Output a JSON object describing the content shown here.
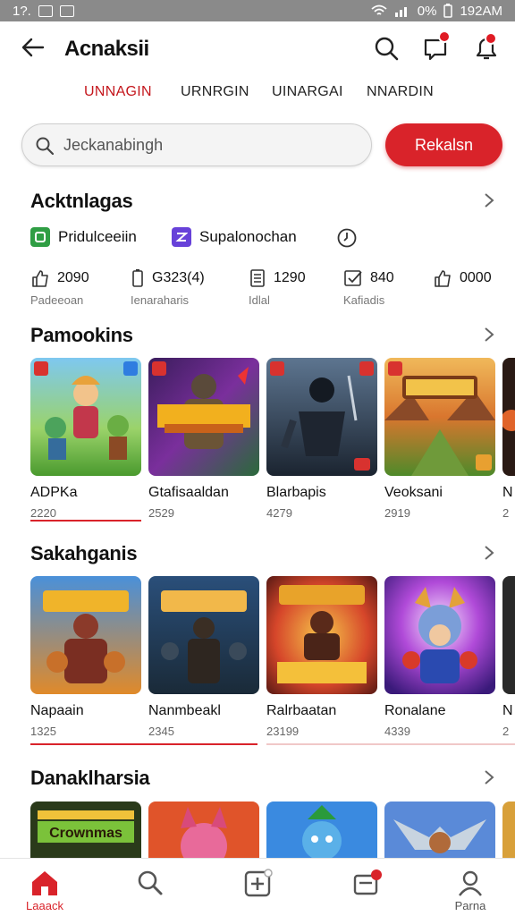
{
  "status": {
    "left_text": "1?.",
    "battery": "0%",
    "time": "192AM"
  },
  "appbar": {
    "title": "Acnaksii"
  },
  "tabs": [
    "UNNAGIN",
    "URNRGIN",
    "UINARGAI",
    "NNARDIN"
  ],
  "search": {
    "placeholder": "Jeckanabingh",
    "button": "Rekalsn"
  },
  "section1": {
    "title": "Acktnlagas",
    "chips": [
      {
        "label": "Pridulceeiin",
        "icon": "green-game-icon",
        "color": "#2f9e44"
      },
      {
        "label": "Supalonochan",
        "icon": "purple-chart-icon",
        "color": "#6741d9"
      },
      {
        "label": "",
        "icon": "clock-icon",
        "color": "#333333"
      }
    ],
    "stats": [
      {
        "value": "2090",
        "label": "Padeeoan",
        "icon": "thumb-up-icon"
      },
      {
        "value": "G323(4)",
        "label": "Ienaraharis",
        "icon": "battery-icon"
      },
      {
        "value": "1290",
        "label": "Idlal",
        "icon": "document-icon"
      },
      {
        "value": "840",
        "label": "Kafiadis",
        "icon": "checkbox-icon"
      },
      {
        "value": "0000",
        "label": "",
        "icon": "external-thumb-icon"
      }
    ]
  },
  "section2": {
    "title": "Pamookins",
    "items": [
      {
        "name": "ADPKa",
        "count": "2220",
        "art": "cartoon-heroes"
      },
      {
        "name": "Gtafisaaldan",
        "count": "2529",
        "art": "dark-warrior-logo"
      },
      {
        "name": "Blarbapis",
        "count": "4279",
        "art": "ninja-shadow"
      },
      {
        "name": "Veoksani",
        "count": "2919",
        "art": "canyon-landscape"
      },
      {
        "name": "N",
        "count": "2",
        "art": "partial"
      }
    ]
  },
  "section3": {
    "title": "Sakahganis",
    "items": [
      {
        "name": "Napaain",
        "count": "1325",
        "art": "armored-brawler"
      },
      {
        "name": "Nanmbeakl",
        "count": "2345",
        "art": "pirate-crew"
      },
      {
        "name": "Ralrbaatan",
        "count": "23199",
        "art": "fire-champion"
      },
      {
        "name": "Ronalane",
        "count": "4339",
        "art": "cartoon-bulldog"
      },
      {
        "name": "N",
        "count": "2",
        "art": "partial"
      }
    ]
  },
  "section4": {
    "title": "Danaklharsia",
    "items": [
      {
        "name": "Crownmas",
        "art": "crown-logo"
      },
      {
        "name": "",
        "art": "red-fox"
      },
      {
        "name": "",
        "art": "blue-mascot"
      },
      {
        "name": "",
        "art": "winged-knight"
      }
    ]
  },
  "bottom_nav": [
    {
      "label": "Laaack",
      "icon": "home-icon",
      "active": true
    },
    {
      "label": "",
      "icon": "search-icon",
      "active": false
    },
    {
      "label": "",
      "icon": "add-square-icon",
      "active": false
    },
    {
      "label": "",
      "icon": "inbox-icon",
      "active": false
    },
    {
      "label": "Parna",
      "icon": "profile-icon",
      "active": false
    }
  ],
  "colors": {
    "accent": "#d9232a",
    "active_tab": "#c4161c",
    "status_bar": "#8a8a8a"
  }
}
